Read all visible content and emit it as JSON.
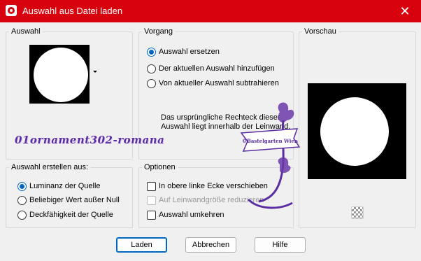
{
  "window": {
    "title": "Auswahl aus Datei laden",
    "close_glyph": "✕"
  },
  "auswahl": {
    "label": "Auswahl",
    "dropdown_icon": "chevron-down-icon"
  },
  "vorgang": {
    "label": "Vorgang",
    "options": [
      {
        "label": "Auswahl ersetzen",
        "selected": true
      },
      {
        "label": "Der aktuellen Auswahl hinzufügen",
        "selected": false
      },
      {
        "label": "Von aktueller Auswahl subtrahieren",
        "selected": false
      }
    ],
    "info_text": "Das ursprüngliche Rechteck dieser Auswahl liegt innerhalb der Leinwand."
  },
  "vorschau": {
    "label": "Vorschau",
    "checker_icon": "transparency-checker-icon"
  },
  "auswahl_erstellen": {
    "label": "Auswahl erstellen aus:",
    "options": [
      {
        "label": "Luminanz der Quelle",
        "selected": true
      },
      {
        "label": "Beliebiger Wert außer Null",
        "selected": false
      },
      {
        "label": "Deckfähigkeit der Quelle",
        "selected": false
      }
    ]
  },
  "optionen": {
    "label": "Optionen",
    "items": [
      {
        "label": "In obere linke Ecke verschieben",
        "checked": false,
        "enabled": true
      },
      {
        "label": "Auf Leinwandgröße reduzieren",
        "checked": false,
        "enabled": false
      },
      {
        "label": "Auswahl umkehren",
        "checked": false,
        "enabled": true
      }
    ]
  },
  "buttons": {
    "ok": "Laden",
    "cancel": "Abbrechen",
    "help": "Hilfe"
  },
  "watermark": {
    "text": "01ornament302-romana",
    "stamp_text": "©Bastelgarten Wien"
  },
  "colors": {
    "titlebar": "#d8020f",
    "accent": "#0067c0",
    "watermark": "#5a2ea0"
  }
}
